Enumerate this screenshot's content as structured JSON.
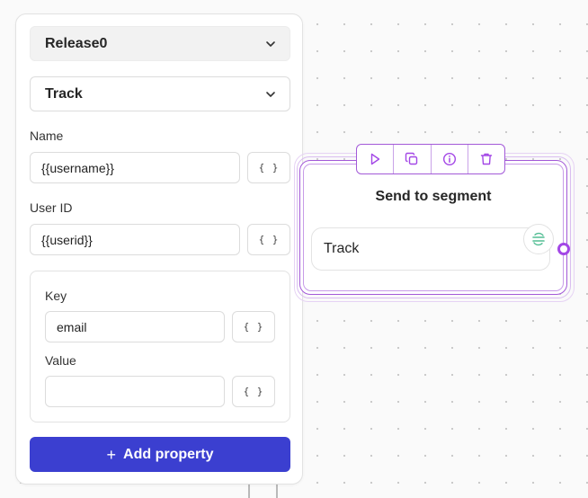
{
  "panel": {
    "release_select": {
      "value": "Release0"
    },
    "event_select": {
      "value": "Track"
    },
    "name_field": {
      "label": "Name",
      "value": "{{username}}"
    },
    "user_id_field": {
      "label": "User ID",
      "value": "{{userid}}"
    },
    "property": {
      "key_label": "Key",
      "key_value": "email",
      "value_label": "Value",
      "value_value": ""
    },
    "variable_button_label": "{ }",
    "add_property_label": "Add property",
    "add_property_icon": "plus-icon"
  },
  "node": {
    "title": "Send to segment",
    "action_label": "Track",
    "toolbar": [
      "play-icon",
      "copy-icon",
      "info-icon",
      "trash-icon"
    ],
    "badge_icon": "segment-logo-icon"
  },
  "colors": {
    "accent_purple": "#a35ad8",
    "primary_button": "#3b3fd0",
    "segment_green": "#52bd94"
  }
}
